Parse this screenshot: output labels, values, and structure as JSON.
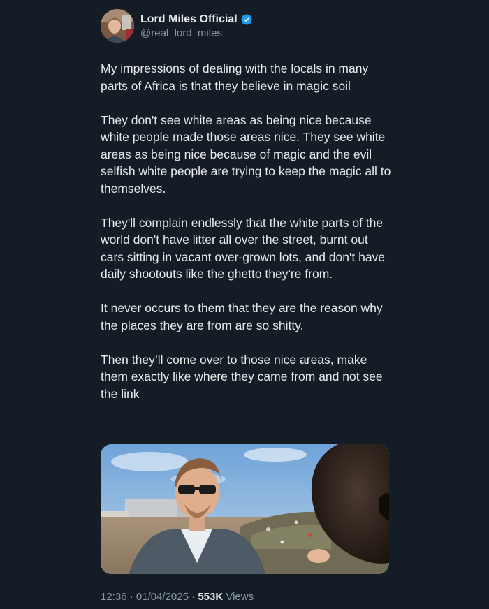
{
  "author": {
    "display_name": "Lord Miles Official",
    "handle": "@real_lord_miles",
    "verified_icon": "verified-badge-icon",
    "accent": "#1d9bf0"
  },
  "tweet": {
    "paragraphs": [
      "My impressions of dealing with the locals in many parts of Africa is that they believe in magic soil",
      "They don't see white areas as being nice because white people made those areas nice. They see white areas as being nice because of magic and the evil selfish white people are trying to keep the magic all to themselves.",
      "They'll complain endlessly that the white parts of the world don't have litter all over the street, burnt out cars sitting in vacant over-grown lots, and don't have daily shootouts like the ghetto they're from.",
      "It never occurs to them that they are the reason why the places they are from are so shitty.",
      "Then they’ll come over to those nice areas, make them exactly like where they came from and not see the link"
    ]
  },
  "meta": {
    "time": "12:36",
    "separator": "·",
    "date": "01/04/2025",
    "views_count": "553K",
    "views_label": "Views"
  },
  "colors": {
    "background": "#141d26",
    "text": "#e7e9ea",
    "secondary": "#8b98a5"
  }
}
